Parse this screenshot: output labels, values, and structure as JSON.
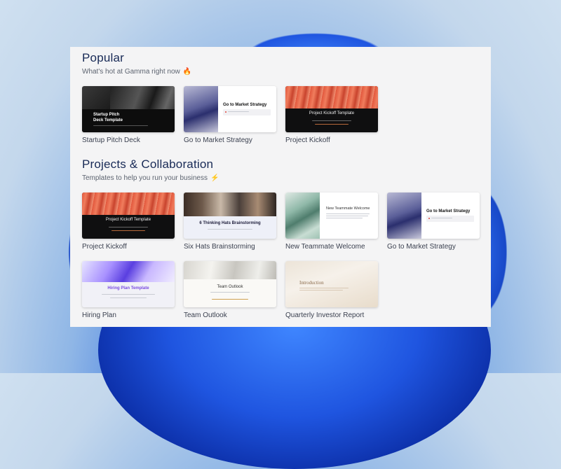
{
  "sections": {
    "popular": {
      "title": "Popular",
      "subtitle": "What's hot at Gamma right now",
      "subtitle_icon": "🔥",
      "cards": [
        {
          "label": "Startup Pitch Deck",
          "thumb_title_1": "Startup Pitch",
          "thumb_title_2": "Deck Template"
        },
        {
          "label": "Go to Market Strategy",
          "thumb_title": "Go to Market Strategy"
        },
        {
          "label": "Project Kickoff",
          "thumb_title": "Project Kickoff Template"
        }
      ]
    },
    "projects": {
      "title": "Projects & Collaboration",
      "subtitle": "Templates to help you run your business",
      "subtitle_icon": "⚡",
      "cards": [
        {
          "label": "Project Kickoff",
          "thumb_title": "Project Kickoff Template"
        },
        {
          "label": "Six Hats Brainstorming",
          "thumb_title": "6 Thinking Hats Brainstorming"
        },
        {
          "label": "New Teammate Welcome",
          "thumb_title": "New Teammate Welcome"
        },
        {
          "label": "Go to Market Strategy",
          "thumb_title": "Go to Market Strategy"
        },
        {
          "label": "Hiring Plan",
          "thumb_title": "Hiring Plan Template"
        },
        {
          "label": "Team Outlook",
          "thumb_title": "Team Outlook"
        },
        {
          "label": "Quarterly Investor Report",
          "thumb_title": "Introduction"
        }
      ]
    }
  },
  "colors": {
    "title": "#182a56",
    "subtitle": "#5d6470",
    "panel_bg": "#f4f4f5"
  }
}
